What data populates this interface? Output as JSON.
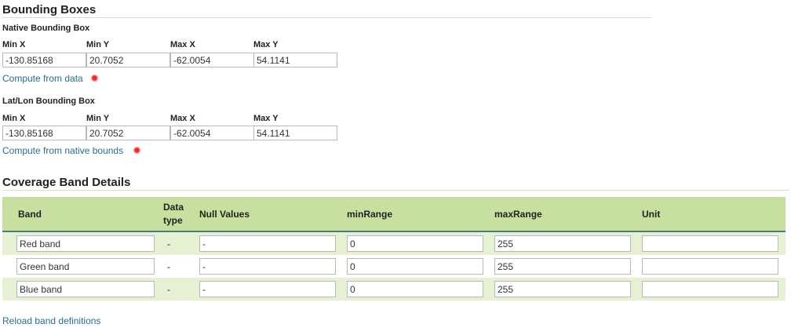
{
  "sections": {
    "bounding_title": "Bounding Boxes",
    "native": {
      "title": "Native Bounding Box",
      "labels": [
        "Min X",
        "Min Y",
        "Max X",
        "Max Y"
      ],
      "values": [
        "-130.85168",
        "20.7052",
        "-62.0054",
        "54.1141"
      ],
      "compute_link": "Compute from data"
    },
    "latlon": {
      "title": "Lat/Lon Bounding Box",
      "labels": [
        "Min X",
        "Min Y",
        "Max X",
        "Max Y"
      ],
      "values": [
        "-130.85168",
        "20.7052",
        "-62.0054",
        "54.1141"
      ],
      "compute_link": "Compute from native bounds"
    },
    "coverage_title": "Coverage Band Details"
  },
  "bands_table": {
    "headers": {
      "band": "Band",
      "data_type_line1": "Data",
      "data_type_line2": "type",
      "null_values": "Null Values",
      "min_range": "minRange",
      "max_range": "maxRange",
      "unit": "Unit"
    },
    "rows": [
      {
        "band": "Red band",
        "data_type": "-",
        "null_values": "-",
        "min_range": "0",
        "max_range": "255",
        "unit": ""
      },
      {
        "band": "Green band",
        "data_type": "-",
        "null_values": "-",
        "min_range": "0",
        "max_range": "255",
        "unit": ""
      },
      {
        "band": "Blue band",
        "data_type": "-",
        "null_values": "-",
        "min_range": "0",
        "max_range": "255",
        "unit": ""
      }
    ]
  },
  "reload_link": "Reload band definitions",
  "colors": {
    "header_bg": "#c7df9f",
    "row_alt_bg": "#e6f0d3",
    "link": "#2a6c93",
    "header_rule": "#4a7f80",
    "marker_dot": "#ff2020"
  }
}
